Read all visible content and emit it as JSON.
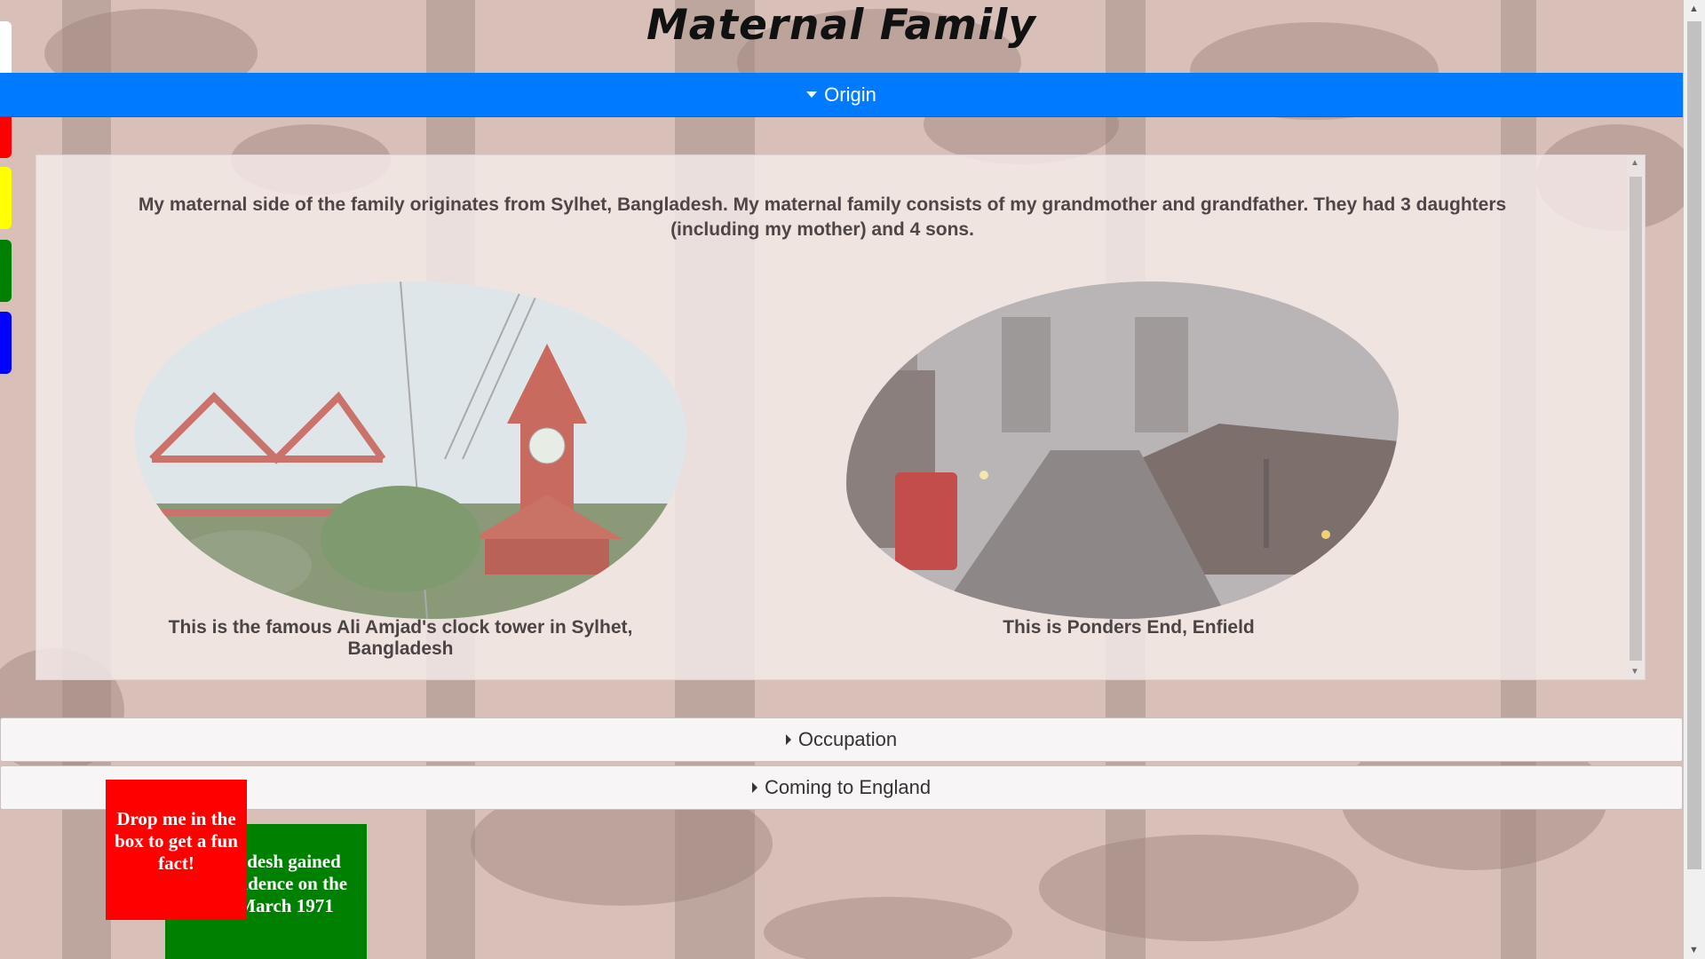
{
  "page": {
    "title": "Maternal Family"
  },
  "side_tabs": [
    {
      "color": "#ffffff"
    },
    {
      "color": "#ff0000"
    },
    {
      "color": "#ffff00"
    },
    {
      "color": "#008000"
    },
    {
      "color": "#0000ff"
    }
  ],
  "accordion": {
    "origin": {
      "label": "Origin",
      "expanded": true,
      "intro": "My maternal side of the family originates from Sylhet, Bangladesh. My maternal family consists of my grandmother and grandfather. They had 3 daughters (including my mother) and 4 sons.",
      "images": [
        {
          "caption": "This is the famous Ali Amjad's clock tower in Sylhet, Bangladesh"
        },
        {
          "caption": "This is Ponders End, Enfield"
        }
      ]
    },
    "occupation": {
      "label": "Occupation",
      "expanded": false
    },
    "coming_to_england": {
      "label": "Coming to England",
      "expanded": false
    }
  },
  "draggables": {
    "drop_box": {
      "text": "Drop me in the box to get a fun fact!",
      "color": "#ff0000"
    },
    "fact_box": {
      "text": "Bangladesh gained independence on the 26th March 1971",
      "color": "#008000"
    }
  },
  "colors": {
    "accent": "#007bff"
  }
}
